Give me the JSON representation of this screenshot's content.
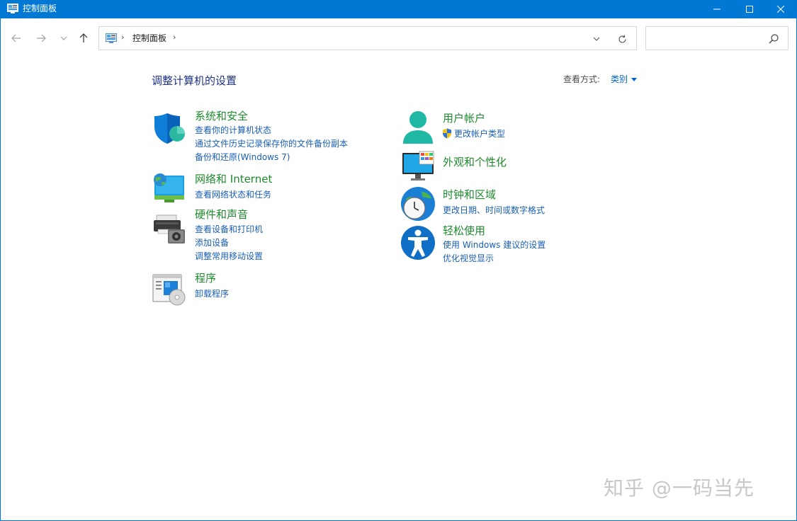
{
  "window": {
    "title": "控制面板"
  },
  "address": {
    "separator": "›",
    "crumb": "控制面板"
  },
  "search": {
    "placeholder": ""
  },
  "content": {
    "page_title": "调整计算机的设置",
    "view_by_label": "查看方式:",
    "view_by_value": "类别"
  },
  "categories": [
    {
      "id": "system-security",
      "title": "系统和安全",
      "links": [
        "查看你的计算机状态",
        "通过文件历史记录保存你的文件备份副本",
        "备份和还原(Windows 7)"
      ]
    },
    {
      "id": "network-internet",
      "title": "网络和 Internet",
      "links": [
        "查看网络状态和任务"
      ]
    },
    {
      "id": "hardware-sound",
      "title": "硬件和声音",
      "links": [
        "查看设备和打印机",
        "添加设备",
        "调整常用移动设置"
      ]
    },
    {
      "id": "programs",
      "title": "程序",
      "links": [
        "卸载程序"
      ]
    },
    {
      "id": "user-accounts",
      "title": "用户帐户",
      "links": [
        "更改帐户类型"
      ]
    },
    {
      "id": "appearance",
      "title": "外观和个性化",
      "links": []
    },
    {
      "id": "clock-region",
      "title": "时钟和区域",
      "links": [
        "更改日期、时间或数字格式"
      ]
    },
    {
      "id": "ease-of-access",
      "title": "轻松使用",
      "links": [
        "使用 Windows 建议的设置",
        "优化视觉显示"
      ]
    }
  ],
  "watermark": "知乎 @一码当先",
  "colors": {
    "titlebar": "#0078d4",
    "category_title": "#1e8a2e",
    "link": "#1a5fb4",
    "page_title": "#1e3287"
  }
}
